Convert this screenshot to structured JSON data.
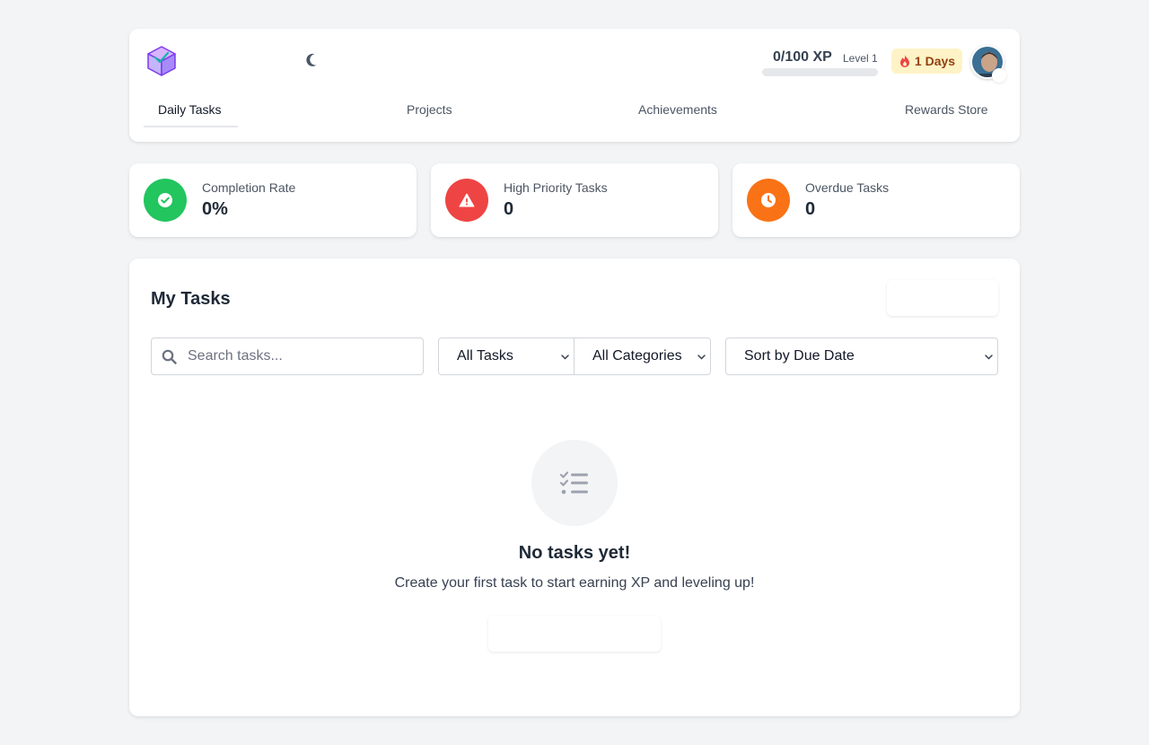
{
  "header": {
    "logo_icon": "cube-logo-icon",
    "theme_toggle_icon": "moon-icon",
    "xp": {
      "current": 0,
      "max": 100,
      "label": "0/100 XP",
      "fill_fraction": 0
    },
    "level_label": "Level 1",
    "streak_label": "1 Days",
    "streak_icon": "fire-icon",
    "tabs": [
      {
        "label": "Daily Tasks",
        "active": true
      },
      {
        "label": "Projects",
        "active": false
      },
      {
        "label": "Achievements",
        "active": false
      },
      {
        "label": "Rewards Store",
        "active": false
      }
    ]
  },
  "stats": [
    {
      "label": "Completion Rate",
      "value": "0%",
      "icon": "check-circle-icon",
      "color": "#22c55e"
    },
    {
      "label": "High Priority Tasks",
      "value": "0",
      "icon": "warning-icon",
      "color": "#ef4444"
    },
    {
      "label": "Overdue Tasks",
      "value": "0",
      "icon": "clock-icon",
      "color": "#f97316"
    }
  ],
  "tasks": {
    "title": "My Tasks",
    "search_placeholder": "Search tasks...",
    "filter_status": "All Tasks",
    "filter_category": "All Categories",
    "sort": "Sort by Due Date",
    "empty": {
      "icon": "task-list-icon",
      "title": "No tasks yet!",
      "subtitle": "Create your first task to start earning XP and leveling up!"
    }
  },
  "colors": {
    "background": "#f3f4f6",
    "card": "#ffffff",
    "xp_bar_track": "#e5e7eb",
    "streak_bg": "#fef3c7",
    "streak_text": "#92400e"
  }
}
